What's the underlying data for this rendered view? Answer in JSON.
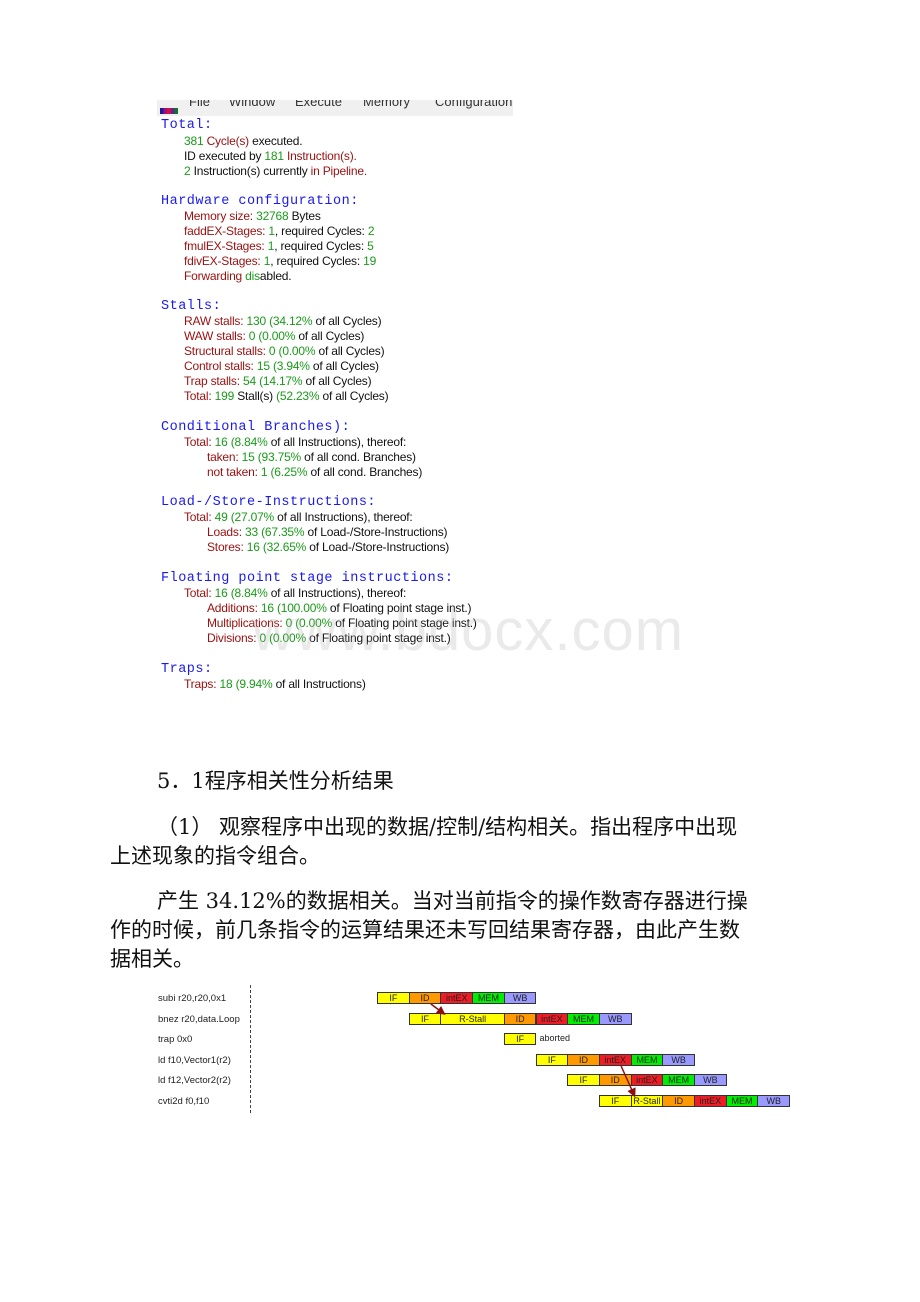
{
  "window": {
    "menu": [
      "File",
      "Window",
      "Execute",
      "Memory",
      "Configuration"
    ]
  },
  "statistics": {
    "total": {
      "title": "Total:",
      "cycles": "381",
      "cycles_label": "Cycle(s)",
      "cycles_suffix": "executed.",
      "id_prefix": "ID executed by",
      "instructions": "181",
      "instructions_label": "Instruction(s).",
      "pipeline_count": "2",
      "pipeline_mid": "Instruction(s) currently",
      "pipeline_label": "in Pipeline."
    },
    "hardware": {
      "title": "Hardware configuration:",
      "memory_label": "Memory size:",
      "memory_value": "32768",
      "memory_unit": "Bytes",
      "fadd_label": "faddEX-Stages:",
      "fadd_stages": "1",
      "fadd_cycles": "2",
      "fmul_label": "fmulEX-Stages:",
      "fmul_stages": "1",
      "fmul_cycles": "5",
      "fdiv_label": "fdivEX-Stages:",
      "fdiv_stages": "1",
      "fdiv_cycles": "19",
      "required_cycles_label": ", required Cycles:",
      "forwarding_label": "Forwarding",
      "forwarding_state": "dis",
      "forwarding_suffix": "abled."
    },
    "stalls": {
      "title": "Stalls:",
      "items": [
        {
          "label": "RAW stalls:",
          "value": "130",
          "pct": "(34.12%",
          "suffix": "of all Cycles)"
        },
        {
          "label": "WAW stalls:",
          "value": "0",
          "pct": "(0.00%",
          "suffix": "of all Cycles)"
        },
        {
          "label": "Structural stalls:",
          "value": "0",
          "pct": "(0.00%",
          "suffix": "of all Cycles)"
        },
        {
          "label": "Control stalls:",
          "value": "15",
          "pct": "(3.94%",
          "suffix": "of all Cycles)"
        },
        {
          "label": "Trap stalls:",
          "value": "54",
          "pct": "(14.17%",
          "suffix": "of all Cycles)"
        }
      ],
      "total_label": "Total:",
      "total_value": "199",
      "total_unit": "Stall(s)",
      "total_pct": "(52.23%",
      "total_suffix": "of all Cycles)"
    },
    "branches": {
      "title": "Conditional Branches):",
      "total_label": "Total:",
      "total_value": "16",
      "total_pct": "(8.84%",
      "total_suffix": "of all Instructions), thereof:",
      "taken_label": "taken:",
      "taken_value": "15",
      "taken_pct": "(93.75%",
      "taken_suffix": "of all cond. Branches)",
      "not_taken_label": "not taken:",
      "not_taken_value": "1",
      "not_taken_pct": "(6.25%",
      "not_taken_suffix": "of all cond. Branches)"
    },
    "loadstore": {
      "title": "Load-/Store-Instructions:",
      "total_label": "Total:",
      "total_value": "49",
      "total_pct": "(27.07%",
      "total_suffix": "of all Instructions), thereof:",
      "loads_label": "Loads:",
      "loads_value": "33",
      "loads_pct": "(67.35%",
      "loads_suffix": "of Load-/Store-Instructions)",
      "stores_label": "Stores:",
      "stores_value": "16",
      "stores_pct": "(32.65%",
      "stores_suffix": "of Load-/Store-Instructions)"
    },
    "floating": {
      "title": "Floating point stage instructions:",
      "total_label": "Total:",
      "total_value": "16",
      "total_pct": "(8.84%",
      "total_suffix": "of all Instructions), thereof:",
      "add_label": "Additions:",
      "add_value": "16",
      "add_pct": "(100.00%",
      "add_suffix": "of Floating point stage inst.)",
      "mul_label": "Multiplications:",
      "mul_value": "0",
      "mul_pct": "(0.00%",
      "mul_suffix": "of Floating point stage inst.)",
      "div_label": "Divisions:",
      "div_value": "0",
      "div_pct": "(0.00%",
      "div_suffix": "of Floating point stage inst.)"
    },
    "traps": {
      "title": "Traps:",
      "label": "Traps:",
      "value": "18",
      "pct": "(9.94%",
      "suffix": "of all Instructions)"
    }
  },
  "watermark": "www.bdocx.com",
  "document": {
    "heading": "5．1程序相关性分析结果",
    "question_line1": "（1） 观察程序中出现的数据/控制/结构相关。指出程序中出现",
    "question_line2": "上述现象的指令组合。",
    "answer_line1": "产生 34.12%的数据相关。当对当前指令的操作数寄存器进行操",
    "answer_line2": "作的时候，前几条指令的运算结果还未写回结果寄存器，由此产生数",
    "answer_line3": "据相关。"
  },
  "pipeline": {
    "instructions": [
      {
        "text": "subi r20,r20,0x1",
        "start": 0,
        "stages": [
          "IF",
          "ID",
          "intEX",
          "MEM",
          "WB"
        ],
        "note": ""
      },
      {
        "text": "bnez r20,data.Loop",
        "start": 1,
        "stages": [
          "IF",
          "R-Stall",
          "R-Stall-cont",
          "ID",
          "intEX",
          "MEM",
          "WB"
        ],
        "note": ""
      },
      {
        "text": "trap 0x0",
        "start": 4,
        "stages": [
          "IF"
        ],
        "note": "aborted"
      },
      {
        "text": "ld f10,Vector1(r2)",
        "start": 5,
        "stages": [
          "IF",
          "ID",
          "intEX",
          "MEM",
          "WB"
        ],
        "note": ""
      },
      {
        "text": "ld f12,Vector2(r2)",
        "start": 6,
        "stages": [
          "IF",
          "ID",
          "intEX",
          "MEM",
          "WB"
        ],
        "note": ""
      },
      {
        "text": "cvti2d f0,f10",
        "start": 7,
        "stages": [
          "IF",
          "R-Stall",
          "ID",
          "intEX",
          "MEM",
          "WB"
        ],
        "note": ""
      }
    ],
    "dependencies": [
      {
        "from_instr": 0,
        "from_cycle": 1,
        "to_instr": 1,
        "to_cycle": 2
      },
      {
        "from_instr": 3,
        "from_cycle": 7,
        "to_instr": 5,
        "to_cycle": 8
      }
    ]
  }
}
